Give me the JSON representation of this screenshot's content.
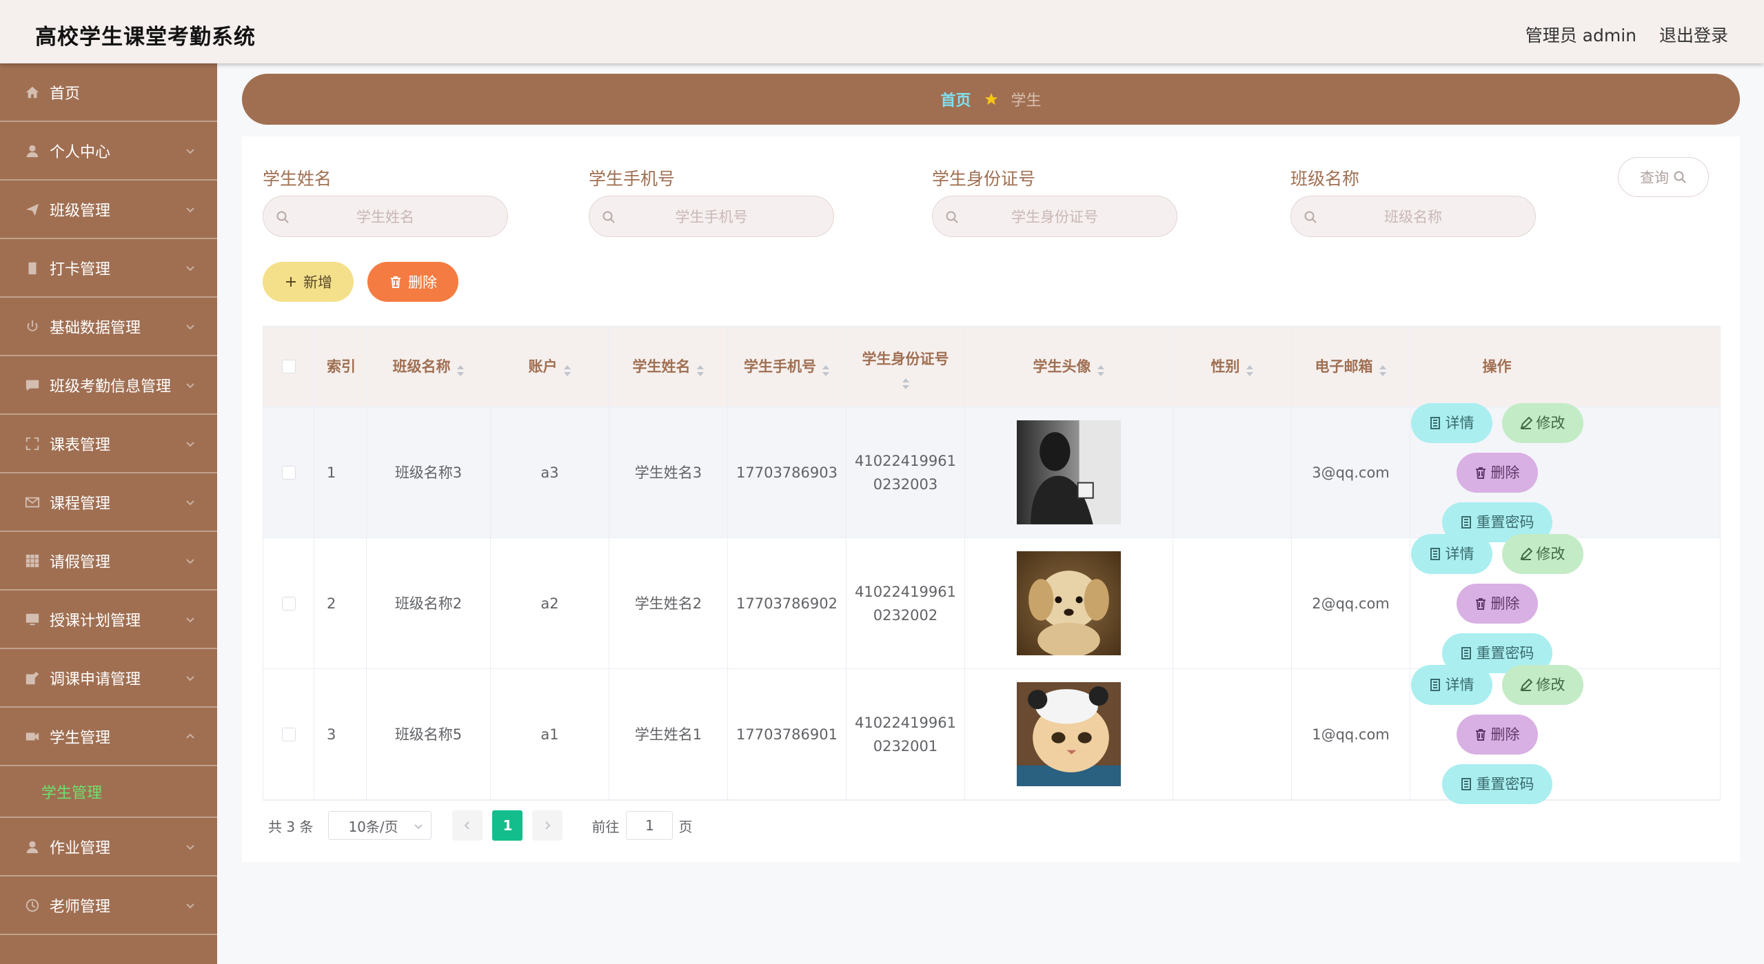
{
  "header": {
    "title": "高校学生课堂考勤系统",
    "user": "管理员 admin",
    "logout": "退出登录"
  },
  "sidebar": {
    "items": [
      {
        "label": "首页",
        "icon": "home-icon"
      },
      {
        "label": "个人中心",
        "icon": "user-icon"
      },
      {
        "label": "班级管理",
        "icon": "send-icon"
      },
      {
        "label": "打卡管理",
        "icon": "clipboard-icon"
      },
      {
        "label": "基础数据管理",
        "icon": "power-icon"
      },
      {
        "label": "班级考勤信息管理",
        "icon": "chat-icon"
      },
      {
        "label": "课表管理",
        "icon": "fullscreen-icon"
      },
      {
        "label": "课程管理",
        "icon": "mail-icon"
      },
      {
        "label": "请假管理",
        "icon": "grid-icon"
      },
      {
        "label": "授课计划管理",
        "icon": "monitor-icon"
      },
      {
        "label": "调课申请管理",
        "icon": "edit-box-icon"
      },
      {
        "label": "学生管理",
        "icon": "video-icon"
      },
      {
        "label": "作业管理",
        "icon": "user-icon"
      },
      {
        "label": "老师管理",
        "icon": "clock-icon"
      }
    ],
    "submenu": "学生管理"
  },
  "breadcrumb": {
    "home": "首页",
    "current": "学生"
  },
  "search": {
    "fields": [
      {
        "label": "学生姓名",
        "placeholder": "学生姓名"
      },
      {
        "label": "学生手机号",
        "placeholder": "学生手机号"
      },
      {
        "label": "学生身份证号",
        "placeholder": "学生身份证号"
      },
      {
        "label": "班级名称",
        "placeholder": "班级名称"
      }
    ],
    "query": "查询"
  },
  "actions": {
    "add": "新增",
    "delete": "删除"
  },
  "table": {
    "headers": [
      "索引",
      "班级名称",
      "账户",
      "学生姓名",
      "学生手机号",
      "学生身份证号",
      "学生头像",
      "性别",
      "电子邮箱",
      "操作"
    ],
    "rows": [
      {
        "index": "1",
        "class": "班级名称3",
        "account": "a3",
        "name": "学生姓名3",
        "phone": "17703786903",
        "id1": "41022419961",
        "id2": "0232003",
        "gender": "",
        "email": "3@qq.com"
      },
      {
        "index": "2",
        "class": "班级名称2",
        "account": "a2",
        "name": "学生姓名2",
        "phone": "17703786902",
        "id1": "41022419961",
        "id2": "0232002",
        "gender": "",
        "email": "2@qq.com"
      },
      {
        "index": "3",
        "class": "班级名称5",
        "account": "a1",
        "name": "学生姓名1",
        "phone": "17703786901",
        "id1": "41022419961",
        "id2": "0232001",
        "gender": "",
        "email": "1@qq.com"
      }
    ],
    "ops": {
      "detail": "详情",
      "edit": "修改",
      "delete": "删除",
      "reset": "重置密码"
    }
  },
  "pager": {
    "total": "共 3 条",
    "size": "10条/页",
    "current": "1",
    "goto": "前往",
    "page_input": "1",
    "page_unit": "页"
  },
  "colors": {
    "accent": "#a06f52",
    "active_page": "#13be8c",
    "submenu_active": "#6ee06e"
  }
}
